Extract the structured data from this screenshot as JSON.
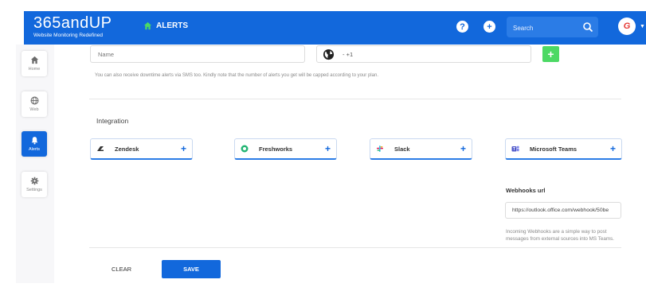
{
  "header": {
    "logo_main": "365andUP",
    "logo_sub": "Website Monitoring Redefined",
    "nav_alerts_label": "ALERTS",
    "help_icon": "?",
    "add_icon": "+",
    "search_placeholder": "Search",
    "avatar_initial": "G",
    "avatar_caret": "▼"
  },
  "sidebar": {
    "items": [
      {
        "label": "Home",
        "icon": "home-icon"
      },
      {
        "label": "Web",
        "icon": "globe-icon"
      },
      {
        "label": "Alerts",
        "icon": "bell-icon",
        "active": true
      },
      {
        "label": "Settings",
        "icon": "gear-icon"
      }
    ]
  },
  "sms": {
    "name_placeholder": "Name",
    "phone_code": "- +1",
    "add_button": "+",
    "note": "You can also receive downtime alerts via SMS too. Kindly note that the number of alerts you get will be capped according to your plan."
  },
  "integration": {
    "title": "Integration",
    "cards": [
      {
        "label": "Zendesk",
        "icon": "zendesk-icon"
      },
      {
        "label": "Freshworks",
        "icon": "freshworks-icon"
      },
      {
        "label": "Slack",
        "icon": "slack-icon"
      },
      {
        "label": "Microsoft Teams",
        "icon": "teams-icon"
      }
    ],
    "plus": "+"
  },
  "webhooks": {
    "label": "Webhooks url",
    "value": "https://outlook.office.com/webhook/50be",
    "note": "Incoming Webhooks are a simple way to post messages from external sources into MS Teams."
  },
  "actions": {
    "clear": "CLEAR",
    "save": "SAVE"
  },
  "colors": {
    "primary": "#1268dc",
    "success": "#4cd964",
    "avatar_text": "#e53935"
  }
}
